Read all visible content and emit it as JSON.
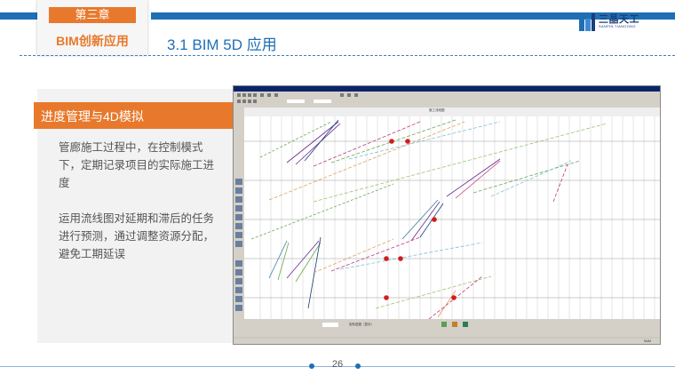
{
  "header": {
    "chapter_tag": "第三章",
    "chapter_subtitle": "BIM创新应用",
    "section_title": "3.1 BIM 5D 应用",
    "logo_text": "三晶天工",
    "logo_sub": "SANPIN TIANGONG",
    "accent_color": "#e8792c",
    "brand_color": "#1f6fb5"
  },
  "topic": {
    "title": "进度管理与4D模拟",
    "paragraphs": [
      "管廊施工过程中，在控制模式下，定期记录项目的实际施工进度",
      "运用流线图对延期和滞后的任务进行预测，通过调整资源分配，避免工期延误"
    ]
  },
  "screenshot": {
    "chart_heading": "施工流线图",
    "bottom_label": "实际进度（显示）",
    "status_text": "NUM",
    "icon_names": [
      "toolbar-icon",
      "flow-chart-icon",
      "red-marker-icon"
    ]
  },
  "footer": {
    "page_number": "26"
  }
}
